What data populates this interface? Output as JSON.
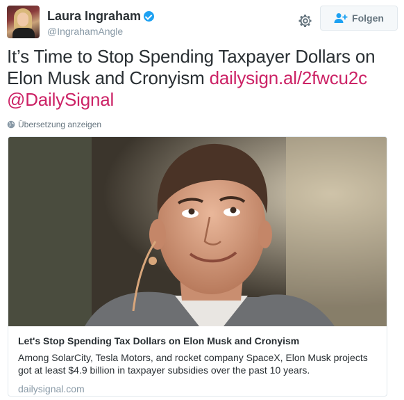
{
  "author": {
    "display_name": "Laura Ingraham",
    "handle": "@IngrahamAngle",
    "verified": true,
    "avatar_icon": "profile-photo"
  },
  "header": {
    "follow_label": "Folgen",
    "gear_icon": "gear-icon",
    "follow_icon": "add-user-icon"
  },
  "tweet": {
    "text": "It’s Time to Stop Spending Taxpayer Dollars on Elon Musk and Cronyism",
    "link": "dailysign.al/2fwcu2c",
    "mention": "@DailySignal",
    "link_color": "#cc2366"
  },
  "translate": {
    "label": "Übersetzung anzeigen",
    "icon": "globe-icon"
  },
  "card": {
    "title": "Let's Stop Spending Tax Dollars on Elon Musk and Cronyism",
    "description": "Among SolarCity, Tesla Motors, and rocket company SpaceX, Elon Musk projects got at least $4.9 billion in taxpayer subsidies over the past 10 years.",
    "domain": "dailysignal.com",
    "image_subject": "portrait-photo"
  }
}
